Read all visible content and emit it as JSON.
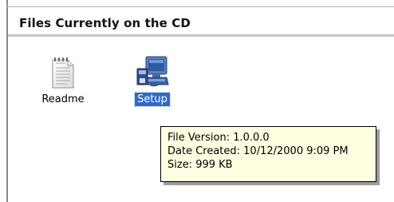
{
  "section": {
    "title": "Files Currently on the CD"
  },
  "files": [
    {
      "label": "Readme",
      "icon": "text-document-icon",
      "selected": false
    },
    {
      "label": "Setup",
      "icon": "setup-installer-icon",
      "selected": true
    }
  ],
  "tooltip": {
    "file_version": "File Version: 1.0.0.0",
    "date_created": "Date Created: 10/12/2000 9:09 PM",
    "size": "Size: 999 KB"
  },
  "colors": {
    "selection": "#316ac5",
    "tooltip_bg": "#ffffe1"
  }
}
